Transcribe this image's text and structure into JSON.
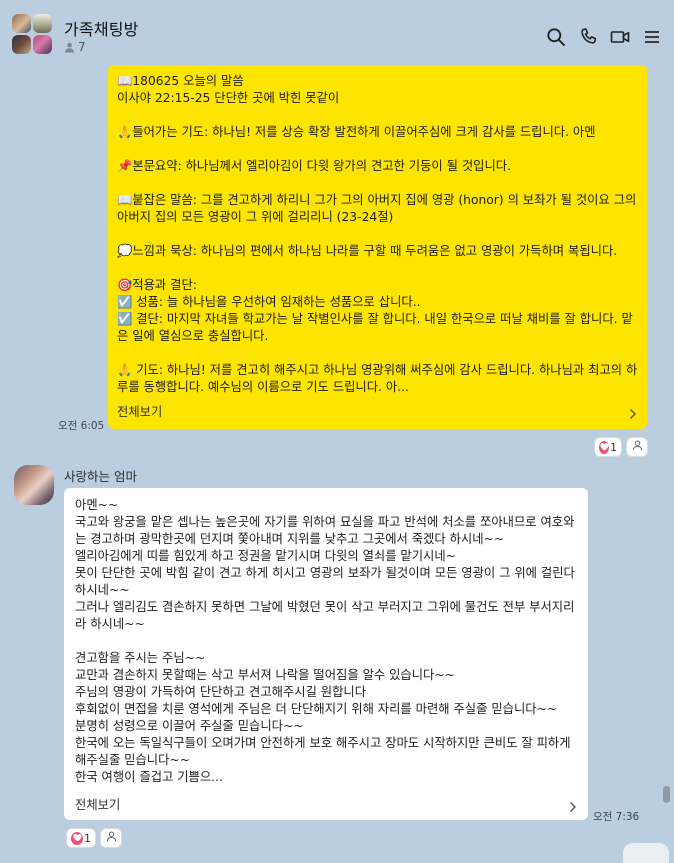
{
  "header": {
    "title": "가족채팅방",
    "member_count": "7"
  },
  "message1": {
    "lines": "📖180625 오늘의 말씀\n이사야 22:15-25 단단한 곳에 박힌 못같이\n\n🙏들어가는 기도: 하나님! 저를 상승 확장 발전하게 이끌어주심에 크게 감사를 드립니다. 아멘\n\n📌본문요약: 하나님께서 엘리아김이 다윗 왕가의 견고한 기둥이 될 것입니다.\n\n📖붙잡은 말씀: 그를 견고하게 하리니 그가 그의 아버지 집에 영광 (honor) 의 보좌가 될 것이요 그의 아버지 집의 모든 영광이 그 위에 걸리리니 (23-24절)\n\n💭느낌과 묵상: 하나님의 편에서 하나님 나라를 구할 때 두려움은 없고 영광이 가득하며 복됩니다.\n\n🎯적용과 결단:\n☑️ 성품: 늘 하나님을 우선하여 임재하는 성품으로 삽니다..\n☑️ 결단: 마지막 자녀들 학교가는 날 작별인사를 잘 합니다. 내일 한국으로 떠날 채비를 잘 합니다. 맡은 일에 열심으로 충실합니다.\n\n🙏 기도: 하나님! 저를 견고히 해주시고 하나님 영광위해 써주심에 감사 드립니다. 하나님과 최고의 하루를 동행합니다. 예수님의 이름으로 기도 드립니다. 아...",
    "more_label": "전체보기",
    "time": "오전 6:05",
    "reaction_count": "1"
  },
  "message2": {
    "sender": "사랑하는 엄마",
    "lines": "아멘~~\n국고와 왕궁을 맡은 셉나는 높은곳에 자기를 위하여 묘실을 파고 반석에 처소를 쪼아내므로 여호와는 경고하며 광막한곳에 던지며 쫓아내며 지위를 낮추고 그곳에서 죽겠다 하시네~~\n엘리아김에게 띠를 힘있게 하고 정권을 맡기시며 다윗의 열쇠를 맡기시네~\n못이 단단한 곳에 박힘 같이 견고 하게 히시고 영광의 보좌가 될것이며 모든 영광이 그 위에 걸린다 하시네~~\n그러나 엘리김도 겸손하지 못하면 그날에 박혔던 못이 삭고 부러지고 그위에 물건도 전부 부서지리라 하시네~~\n\n견고함을 주시는 주님~~\n교만과 겸손하지 못할때는 삭고 부서져 나락을 떨어짐을 알수 있습니다~~\n주님의 영광이 가득하여 단단하고 견고해주시길 원합니다\n후회없이 면접을 치룬 영석에게 주님은 더 단단해지기 위해 자리를 마련해 주실줄 믿습니다~~\n분명히 성령으로 이끌어 주실줄 믿습니다~~\n한국에 오는 독일식구들이 오며가며 안전하게 보호 해주시고 장마도 시작하지만 큰비도 잘 피하게 해주실줄 믿습니다~~\n한국 여행이 즐겁고 기쁨으...",
    "more_label": "전체보기",
    "time": "오전 7:36",
    "reaction_count": "1"
  },
  "colors": {
    "background": "#bacee0",
    "my_bubble": "#fee500",
    "other_bubble": "#ffffff",
    "heart": "#f0506e"
  },
  "icons": [
    "search-icon",
    "phone-icon",
    "video-call-icon",
    "menu-icon",
    "person-icon",
    "heart-icon",
    "chevron-right-icon"
  ]
}
